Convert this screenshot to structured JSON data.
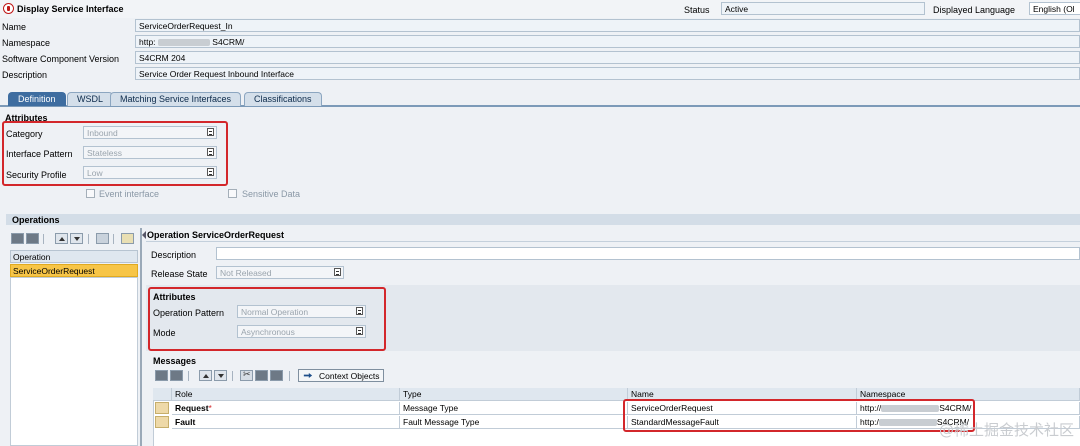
{
  "window": {
    "title": "Display Service Interface"
  },
  "header": {
    "status_label": "Status",
    "status_value": "Active",
    "language_label": "Displayed Language",
    "language_value": "English (Ol"
  },
  "info_fields": [
    {
      "label": "Name",
      "value": "ServiceOrderRequest_In"
    },
    {
      "label": "Namespace",
      "value_prefix": "http:",
      "value_suffix": "S4CRM/"
    },
    {
      "label": "Software Component Version",
      "value": "S4CRM 204"
    },
    {
      "label": "Description",
      "value": "Service Order Request Inbound Interface"
    }
  ],
  "tabs": [
    {
      "label": "Definition",
      "active": true
    },
    {
      "label": "WSDL",
      "active": false
    },
    {
      "label": "Matching Service Interfaces",
      "active": false
    },
    {
      "label": "Classifications",
      "active": false
    }
  ],
  "attributes": {
    "title": "Attributes",
    "category_label": "Category",
    "category_value": "Inbound",
    "pattern_label": "Interface Pattern",
    "pattern_value": "Stateless",
    "security_label": "Security Profile",
    "security_value": "Low",
    "event_interface_label": "Event interface",
    "sensitive_data_label": "Sensitive Data"
  },
  "operations": {
    "title": "Operations",
    "list_header": "Operation",
    "items": [
      "ServiceOrderRequest"
    ]
  },
  "operation_detail": {
    "title": "Operation ServiceOrderRequest",
    "description_label": "Description",
    "release_state_label": "Release State",
    "release_state_value": "Not Released",
    "attributes_title": "Attributes",
    "op_pattern_label": "Operation Pattern",
    "op_pattern_value": "Normal Operation",
    "mode_label": "Mode",
    "mode_value": "Asynchronous"
  },
  "messages": {
    "title": "Messages",
    "context_objects_label": "Context Objects",
    "columns": [
      "Role",
      "Type",
      "Name",
      "Namespace"
    ],
    "rows": [
      {
        "role": "Request",
        "required_mark": "*",
        "type": "Message Type",
        "name": "ServiceOrderRequest",
        "ns_prefix": "http://",
        "ns_suffix": "S4CRM/"
      },
      {
        "role": "Fault",
        "required_mark": "",
        "type": "Fault Message Type",
        "name": "StandardMessageFault",
        "ns_prefix": "http:/",
        "ns_suffix": "S4CRM/"
      }
    ]
  },
  "watermark": "@稀土掘金技术社区",
  "colors": {
    "highlight_red": "#d3272b",
    "tab_active": "#3e6da0",
    "selected_row": "#f7c547"
  }
}
